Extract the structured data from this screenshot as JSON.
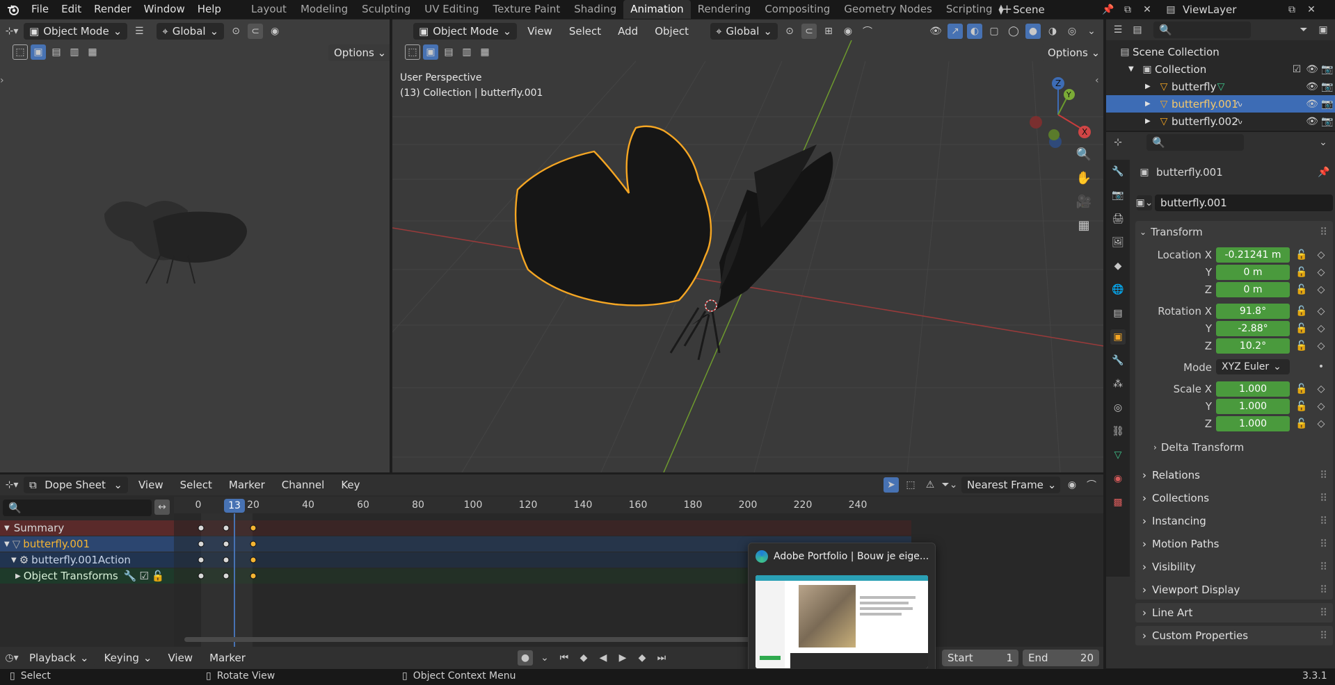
{
  "menubar": {
    "menus": [
      "File",
      "Edit",
      "Render",
      "Window",
      "Help"
    ],
    "workspaces": [
      "Layout",
      "Modeling",
      "Sculpting",
      "UV Editing",
      "Texture Paint",
      "Shading",
      "Animation",
      "Rendering",
      "Compositing",
      "Geometry Nodes",
      "Scripting"
    ],
    "active_workspace": "Animation",
    "scene": "Scene",
    "view_layer": "ViewLayer"
  },
  "left_view": {
    "mode": "Object Mode",
    "orientation": "Global",
    "options_label": "Options"
  },
  "main_view": {
    "mode": "Object Mode",
    "menus": [
      "View",
      "Select",
      "Add",
      "Object"
    ],
    "orientation": "Global",
    "options_label": "Options",
    "overlay_line1": "User Perspective",
    "overlay_line2": "(13) Collection | butterfly.001",
    "gizmo_x": "X",
    "gizmo_y": "Y",
    "gizmo_z": "Z"
  },
  "outliner": {
    "root": "Scene Collection",
    "collection": "Collection",
    "items": [
      "butterfly",
      "butterfly.001",
      "butterfly.002"
    ],
    "selected": "butterfly.001"
  },
  "properties": {
    "object_name": "butterfly.001",
    "data_name": "butterfly.001",
    "transform_title": "Transform",
    "location_label": "Location X",
    "location": [
      "-0.21241 m",
      "0 m",
      "0 m"
    ],
    "rotation_label": "Rotation X",
    "rotation": [
      "91.8°",
      "-2.88°",
      "10.2°"
    ],
    "axis_y": "Y",
    "axis_z": "Z",
    "mode_label": "Mode",
    "mode_value": "XYZ Euler",
    "scale_label": "Scale X",
    "scale": [
      "1.000",
      "1.000",
      "1.000"
    ],
    "delta": "Delta Transform",
    "sections": [
      "Relations",
      "Collections",
      "Instancing",
      "Motion Paths",
      "Visibility",
      "Viewport Display",
      "Line Art",
      "Custom Properties"
    ]
  },
  "dopesheet": {
    "editor": "Dope Sheet",
    "menus": [
      "View",
      "Select",
      "Marker",
      "Channel",
      "Key"
    ],
    "snap": "Nearest Frame",
    "current_frame": "13",
    "ticks": [
      "0",
      "20",
      "40",
      "60",
      "80",
      "100",
      "120",
      "140",
      "160",
      "180",
      "200",
      "220",
      "240"
    ],
    "channels": [
      "Summary",
      "butterfly.001",
      "butterfly.001Action",
      "Object Transforms"
    ],
    "keyframes": [
      1,
      10,
      20
    ]
  },
  "timeline": {
    "menus": [
      "Playback",
      "Keying",
      "View",
      "Marker"
    ],
    "start_label": "Start",
    "start": "1",
    "end_label": "End",
    "end": "20"
  },
  "preview": {
    "title": "Adobe Portfolio | Bouw je eige..."
  },
  "statusbar": {
    "items": [
      "Select",
      "Rotate View",
      "Object Context Menu"
    ],
    "version": "3.3.1"
  },
  "colors": {
    "selection_orange": "#f5a623",
    "field_green": "#4a9a3d",
    "highlight_blue": "#3d6cb5",
    "keyframe_selected": "#f5b533"
  }
}
